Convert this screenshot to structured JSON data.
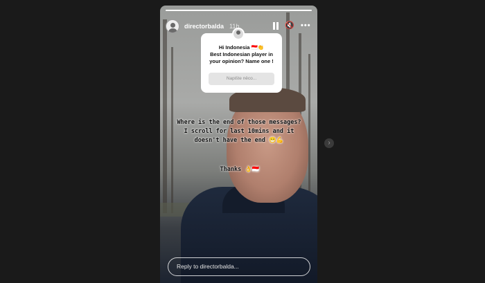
{
  "story": {
    "username": "directorbalda",
    "time_ago": "11h",
    "progress": 1.0
  },
  "controls": {
    "pause_icon": "pause-icon",
    "mute_icon": "speaker-muted-icon",
    "mute_glyph": "🔇",
    "more_label": "•••"
  },
  "question_sticker": {
    "text": "Hi Indonesia 🇮🇩👏\nBest Indonesian player in your opinion? Name one !",
    "input_placeholder": "Napište něco..."
  },
  "overlay_text": {
    "message": "Where is the end of those messages?\nI scroll for last 10mins and it\ndoesn't have the end 😁💪",
    "thanks": "Thanks 👌🇮🇩"
  },
  "reply": {
    "placeholder": "Reply to directorbalda..."
  },
  "navigation": {
    "next_glyph": "›"
  },
  "colors": {
    "page_background": "#1a1a1a",
    "sticker_background": "#ffffff",
    "text_white": "#ffffff"
  }
}
